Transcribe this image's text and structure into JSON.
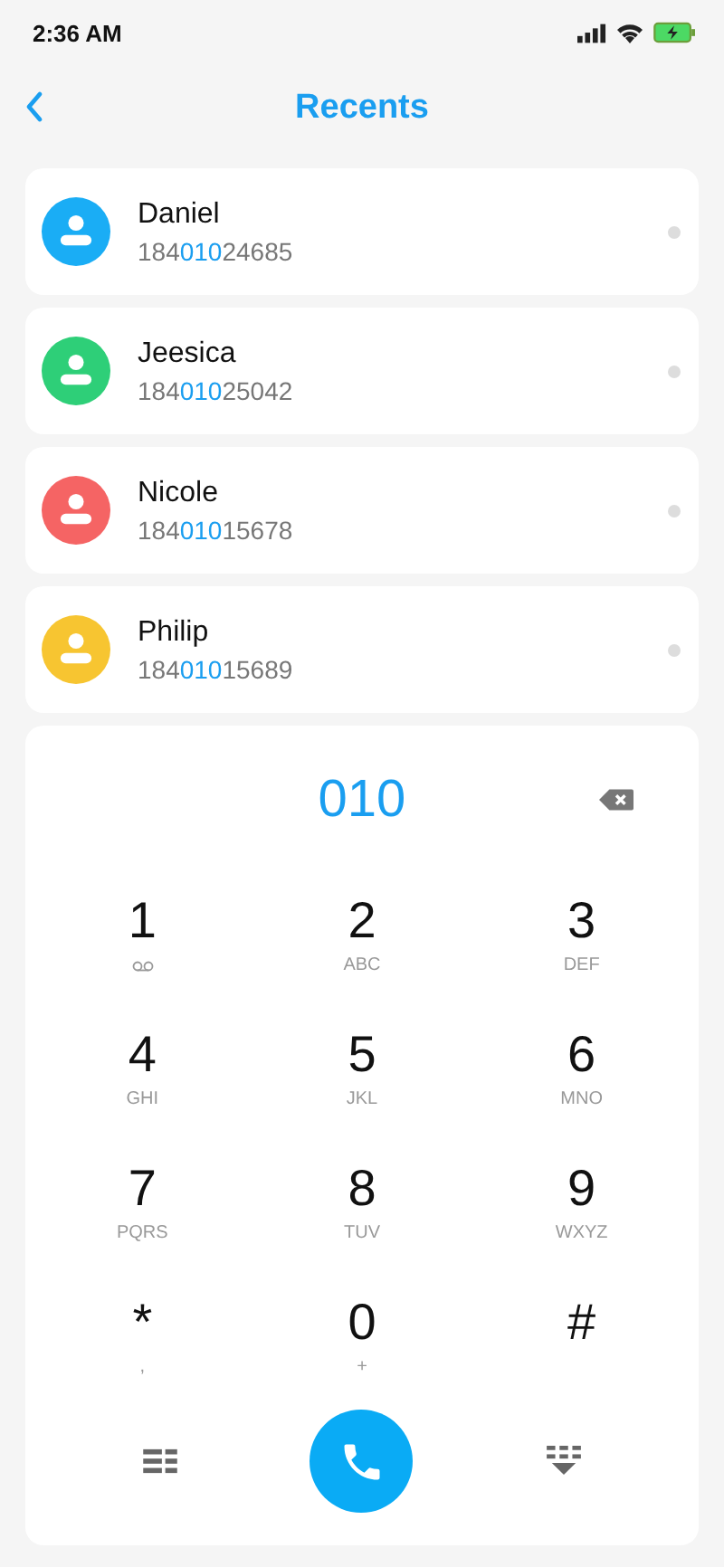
{
  "status_bar": {
    "time": "2:36 AM"
  },
  "header": {
    "title": "Recents"
  },
  "contacts": [
    {
      "name": "Daniel",
      "number_prefix": "184",
      "number_match": "010",
      "number_suffix": "24685",
      "color": "#1aadf5"
    },
    {
      "name": "Jeesica",
      "number_prefix": "184",
      "number_match": "010",
      "number_suffix": "25042",
      "color": "#2ecf78"
    },
    {
      "name": "Nicole",
      "number_prefix": "184",
      "number_match": "010",
      "number_suffix": "15678",
      "color": "#f56464"
    },
    {
      "name": "Philip",
      "number_prefix": "184",
      "number_match": "010",
      "number_suffix": "15689",
      "color": "#f7c531"
    }
  ],
  "dialpad": {
    "entry": "010",
    "keys": [
      {
        "digit": "1",
        "kind": "voicemail"
      },
      {
        "digit": "2",
        "kind": "letters",
        "letters": "ABC"
      },
      {
        "digit": "3",
        "kind": "letters",
        "letters": "DEF"
      },
      {
        "digit": "4",
        "kind": "letters",
        "letters": "GHI"
      },
      {
        "digit": "5",
        "kind": "letters",
        "letters": "JKL"
      },
      {
        "digit": "6",
        "kind": "letters",
        "letters": "MNO"
      },
      {
        "digit": "7",
        "kind": "letters",
        "letters": "PQRS"
      },
      {
        "digit": "8",
        "kind": "letters",
        "letters": "TUV"
      },
      {
        "digit": "9",
        "kind": "letters",
        "letters": "WXYZ"
      },
      {
        "digit": "*",
        "kind": "letters",
        "letters": ","
      },
      {
        "digit": "0",
        "kind": "letters",
        "letters": "+"
      },
      {
        "digit": "#",
        "kind": "plain"
      }
    ]
  }
}
